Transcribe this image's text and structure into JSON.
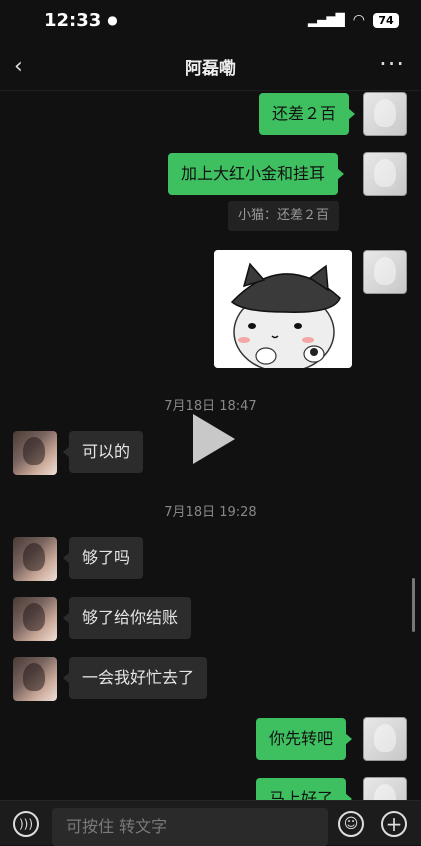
{
  "status_bar": {
    "time": "12:33",
    "battery": "74"
  },
  "header": {
    "title": "阿磊嘞",
    "back_icon": "chevron-left-icon",
    "more_icon": "more-dots-icon"
  },
  "messages": [
    {
      "side": "right",
      "text": "还差２百"
    },
    {
      "side": "right",
      "text": "加上大红小金和挂耳"
    },
    {
      "quote": "小猫：还差２百"
    },
    {
      "side": "right",
      "type": "sticker"
    },
    {
      "timestamp": "7月18日 18:47"
    },
    {
      "side": "left",
      "text": "可以的"
    },
    {
      "timestamp": "7月18日 19:28"
    },
    {
      "side": "left",
      "text": "够了吗"
    },
    {
      "side": "left",
      "text": "够了给你结账"
    },
    {
      "side": "left",
      "text": "一会我好忙去了"
    },
    {
      "side": "right",
      "text": "你先转吧"
    },
    {
      "side": "right",
      "text": "马上好了"
    }
  ],
  "input_bar": {
    "placeholder": "可按住 转文字",
    "voice_icon": "voice-icon",
    "emoji_icon": "emoji-icon",
    "plus_icon": "plus-icon"
  },
  "colors": {
    "green_bubble": "#3ec061",
    "gray_bubble": "#2c2c2c",
    "background": "#111111"
  }
}
